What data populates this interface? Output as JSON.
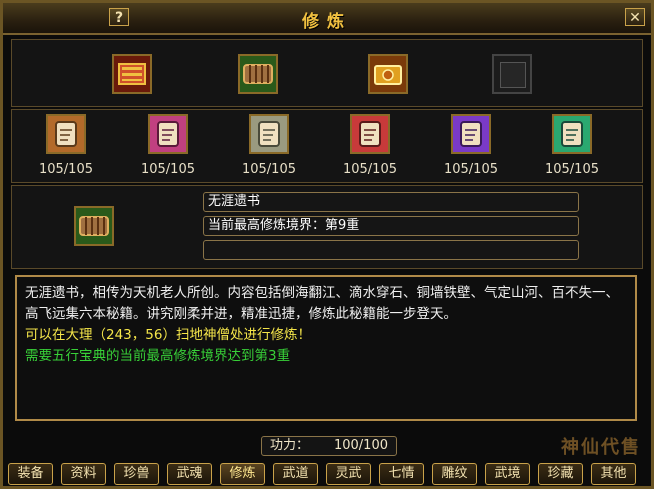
{
  "window": {
    "title": "修炼",
    "help_label": "?",
    "close_label": "✕"
  },
  "top_slots": [
    {
      "icon": "red-tome-icon"
    },
    {
      "icon": "bamboo-scroll-icon"
    },
    {
      "icon": "gold-tome-icon"
    },
    {
      "icon": "empty-slot"
    }
  ],
  "scrolls": [
    {
      "icon": "brown-scroll-icon",
      "count": "105/105",
      "color": "#b36a2a"
    },
    {
      "icon": "pink-scroll-icon",
      "count": "105/105",
      "color": "#c04080"
    },
    {
      "icon": "grey-scroll-icon",
      "count": "105/105",
      "color": "#9a9a80"
    },
    {
      "icon": "red-scroll-icon",
      "count": "105/105",
      "color": "#c83a3a"
    },
    {
      "icon": "purple-scroll-icon",
      "count": "105/105",
      "color": "#7a3ac8"
    },
    {
      "icon": "green-scroll-icon",
      "count": "105/105",
      "color": "#2aa870"
    }
  ],
  "selected": {
    "icon": "bamboo-scroll-icon",
    "name": "无涯遗书",
    "level": "当前最高修炼境界：第9重",
    "extra": ""
  },
  "description": {
    "text": "无涯遗书，相传为天机老人所创。内容包括倒海翻江、滴水穿石、铜墙铁壁、气定山河、百不失一、高飞远集六本秘籍。讲究刚柔并进，精准迅捷，修炼此秘籍能一步登天。",
    "location": "可以在大理（243，56）扫地神僧处进行修炼！",
    "requirement": "需要五行宝典的当前最高修炼境界达到第3重"
  },
  "power": {
    "label": "功力：",
    "value": "100/100"
  },
  "tabs": [
    "装备",
    "资料",
    "珍兽",
    "武魂",
    "修炼",
    "武道",
    "灵武",
    "七情",
    "雕纹",
    "武境",
    "珍藏",
    "其他"
  ],
  "active_tab": "修炼",
  "watermark": "神仙代售"
}
